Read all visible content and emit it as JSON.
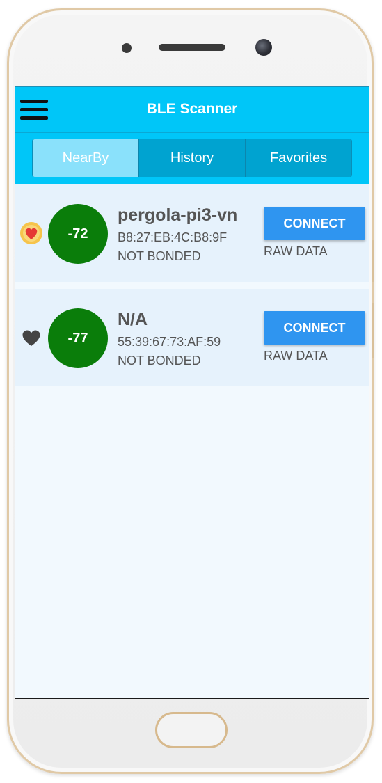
{
  "app": {
    "title": "BLE Scanner"
  },
  "tabs": [
    {
      "label": "NearBy",
      "active": true
    },
    {
      "label": "History",
      "active": false
    },
    {
      "label": "Favorites",
      "active": false
    }
  ],
  "devices": [
    {
      "name": "pergola-pi3-vn",
      "rssi": "-72",
      "mac": "B8:27:EB:4C:B8:9F",
      "bond_state": "NOT BONDED",
      "favorite": true,
      "connect_label": "CONNECT",
      "raw_data_label": "RAW DATA"
    },
    {
      "name": "N/A",
      "rssi": "-77",
      "mac": "55:39:67:73:AF:59",
      "bond_state": "NOT BONDED",
      "favorite": false,
      "connect_label": "CONNECT",
      "raw_data_label": "RAW DATA"
    }
  ],
  "icons": {
    "menu": "hamburger-menu-icon",
    "favorite_on": "heart-filled-icon",
    "favorite_off": "heart-outline-icon"
  },
  "colors": {
    "appbar": "#00c6f8",
    "tab_active": "#8ae1fb",
    "tab_inactive": "#00a3d0",
    "rssi_badge": "#0a7d0a",
    "connect_button": "#2f95f0",
    "favorite_heart": "#e53935",
    "favorite_badge": "#f6c44b",
    "heart_inactive": "#444444",
    "screen_bg": "#f2f9fe",
    "row_bg": "#e6f2fc"
  }
}
